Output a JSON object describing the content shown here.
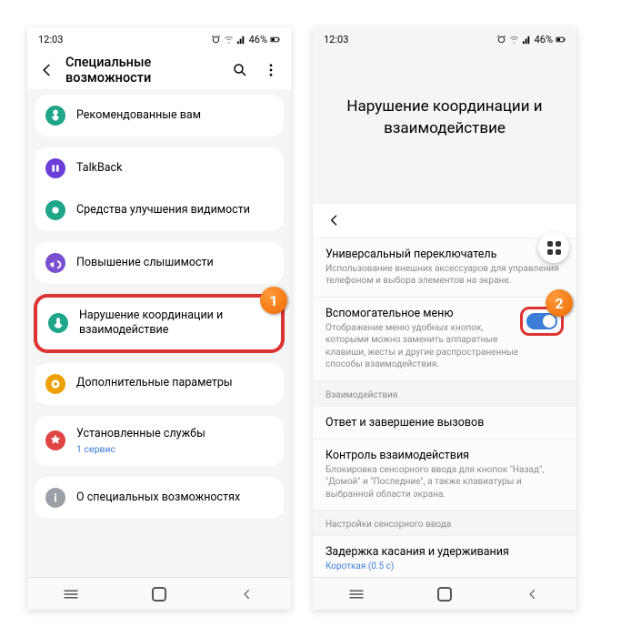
{
  "status": {
    "time": "12:03",
    "battery": "46%"
  },
  "phone1": {
    "header_title": "Специальные возможности",
    "groups": [
      {
        "items": [
          {
            "id": "recommended",
            "icon_color": "#1fa58a",
            "label": "Рекомендованные вам"
          }
        ]
      },
      {
        "items": [
          {
            "id": "talkback",
            "icon_color": "#6a3fd8",
            "label": "TalkBack"
          },
          {
            "id": "visibility",
            "icon_color": "#1fa58a",
            "label": "Средства улучшения видимости"
          }
        ]
      },
      {
        "items": [
          {
            "id": "hearing",
            "icon_color": "#7a4fd0",
            "label": "Повышение слышимости"
          }
        ]
      },
      {
        "items": [
          {
            "id": "interaction",
            "icon_color": "#1fa58a",
            "label": "Нарушение координации и взаимодействие"
          }
        ],
        "highlight": true
      },
      {
        "items": [
          {
            "id": "advanced",
            "icon_color": "#f0a000",
            "label": "Дополнительные параметры"
          }
        ]
      },
      {
        "items": [
          {
            "id": "installed",
            "icon_color": "#e04545",
            "label": "Установленные службы",
            "sub": "1 сервис"
          }
        ]
      },
      {
        "items": [
          {
            "id": "about",
            "icon_color": "#9aa0a6",
            "label": "О специальных возможностях"
          }
        ]
      }
    ]
  },
  "phone2": {
    "page_title": "Нарушение координации и взаимодействие",
    "items": [
      {
        "id": "universal-switch",
        "title": "Универсальный переключатель",
        "desc": "Использование внешних аксессуаров для управления телефоном и выбора элементов на экране."
      },
      {
        "id": "assistant-menu",
        "title": "Вспомогательное меню",
        "desc": "Отображение меню удобных кнопок, которыми можно заменить аппаратные клавиши, жесты и другие распространенные способы взаимодействия.",
        "toggle": true,
        "highlight_toggle": true
      }
    ],
    "section1": "Взаимодействия",
    "items2": [
      {
        "id": "answer-end",
        "title": "Ответ и завершение вызовов"
      },
      {
        "id": "interaction-control",
        "title": "Контроль взаимодействия",
        "desc": "Блокировка сенсорного ввода для кнопок \"Назад\", \"Домой\" и \"Последние\", а также клавиатуры и выбранной области экрана."
      }
    ],
    "section2": "Настройки сенсорного ввода",
    "items3": [
      {
        "id": "touch-hold",
        "title": "Задержка касания и удерживания",
        "sub": "Короткая (0.5 с)"
      }
    ]
  },
  "badge1": "1",
  "badge2": "2"
}
